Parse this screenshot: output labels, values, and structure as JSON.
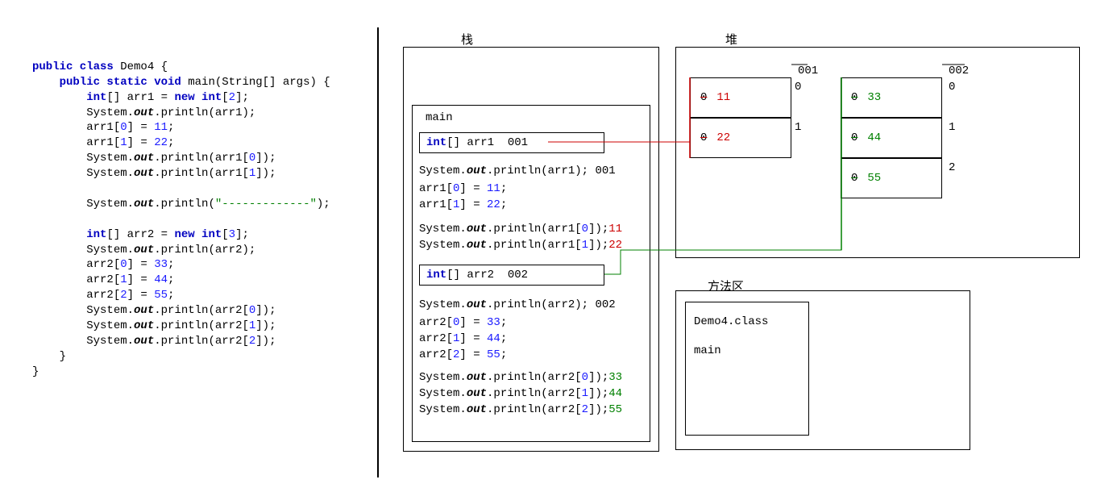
{
  "labels": {
    "stack": "栈",
    "heap": "堆",
    "method_area": "方法区",
    "main": "main"
  },
  "code": {
    "class_decl": "public class Demo4 {",
    "main_decl": "public static void main(String[] args) {",
    "arr1_decl": "int[] arr1 = new int[2];",
    "print_arr1": "System.out.println(arr1);",
    "arr1_0_assign": "arr1[0] = 11;",
    "arr1_1_assign": "arr1[1] = 22;",
    "print_arr1_0": "System.out.println(arr1[0]);",
    "print_arr1_1": "System.out.println(arr1[1]);",
    "sep": "System.out.println(\"-------------\");",
    "arr2_decl": "int[] arr2 = new int[3];",
    "print_arr2": "System.out.println(arr2);",
    "arr2_0_assign": "arr2[0] = 33;",
    "arr2_1_assign": "arr2[1] = 44;",
    "arr2_2_assign": "arr2[2] = 55;",
    "print_arr2_0": "System.out.println(arr2[0]);",
    "print_arr2_1": "System.out.println(arr2[1]);",
    "print_arr2_2": "System.out.println(arr2[2]);"
  },
  "stack": {
    "arr1_box": "int[] arr1  001",
    "arr2_box": "int[] arr2  002",
    "print_arr1": "System.out.println(arr1); 001",
    "arr1_0": "arr1[0] = 11;",
    "arr1_1": "arr1[1] = 22;",
    "print_arr1_0": "System.out.println(arr1[0]);",
    "print_arr1_1": "System.out.println(arr1[1]);",
    "out_11": "11",
    "out_22": "22",
    "print_arr2": "System.out.println(arr2); 002",
    "arr2_0": "arr2[0] = 33;",
    "arr2_1": "arr2[1] = 44;",
    "arr2_2": "arr2[2] = 55;",
    "print_arr2_0": "System.out.println(arr2[0]);",
    "print_arr2_1": "System.out.println(arr2[1]);",
    "print_arr2_2": "System.out.println(arr2[2]);",
    "out_33": "33",
    "out_44": "44",
    "out_55": "55"
  },
  "heap": {
    "arr1": {
      "address": "001",
      "cells": [
        {
          "old": "0",
          "val": "11",
          "idx": "0"
        },
        {
          "old": "0",
          "val": "22",
          "idx": "1"
        }
      ]
    },
    "arr2": {
      "address": "002",
      "cells": [
        {
          "old": "0",
          "val": "33",
          "idx": "0"
        },
        {
          "old": "0",
          "val": "44",
          "idx": "1"
        },
        {
          "old": "0",
          "val": "55",
          "idx": "2"
        }
      ]
    }
  },
  "method_area": {
    "class_file": "Demo4.class",
    "method": "main"
  }
}
